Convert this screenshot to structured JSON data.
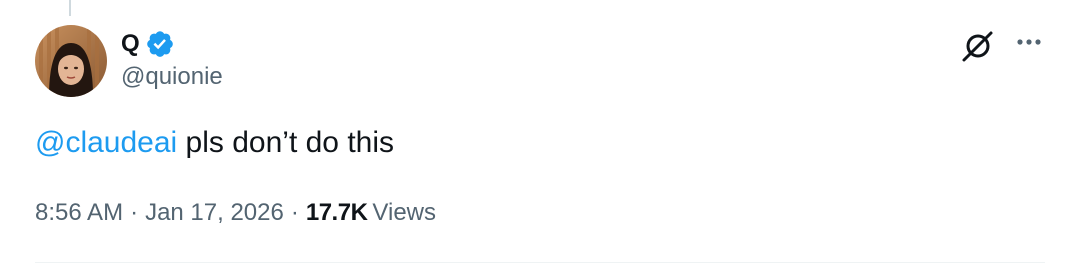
{
  "tweet": {
    "author": {
      "display_name": "Q",
      "handle": "@quionie",
      "verified": true
    },
    "text": {
      "mention": "@claudeai",
      "body": " pls don’t do this"
    },
    "meta": {
      "time": "8:56 AM",
      "separator_1": "·",
      "date": "Jan 17, 2026",
      "separator_2": "·",
      "views_count": "17.7K",
      "views_label": "Views"
    }
  },
  "icons": {
    "verified": "verified-badge-icon",
    "grok": "grok-icon",
    "more": "more-horizontal-icon"
  },
  "colors": {
    "accent": "#1d9bf0",
    "text_primary": "#0f1419",
    "text_secondary": "#536471",
    "divider": "#eff3f4"
  }
}
